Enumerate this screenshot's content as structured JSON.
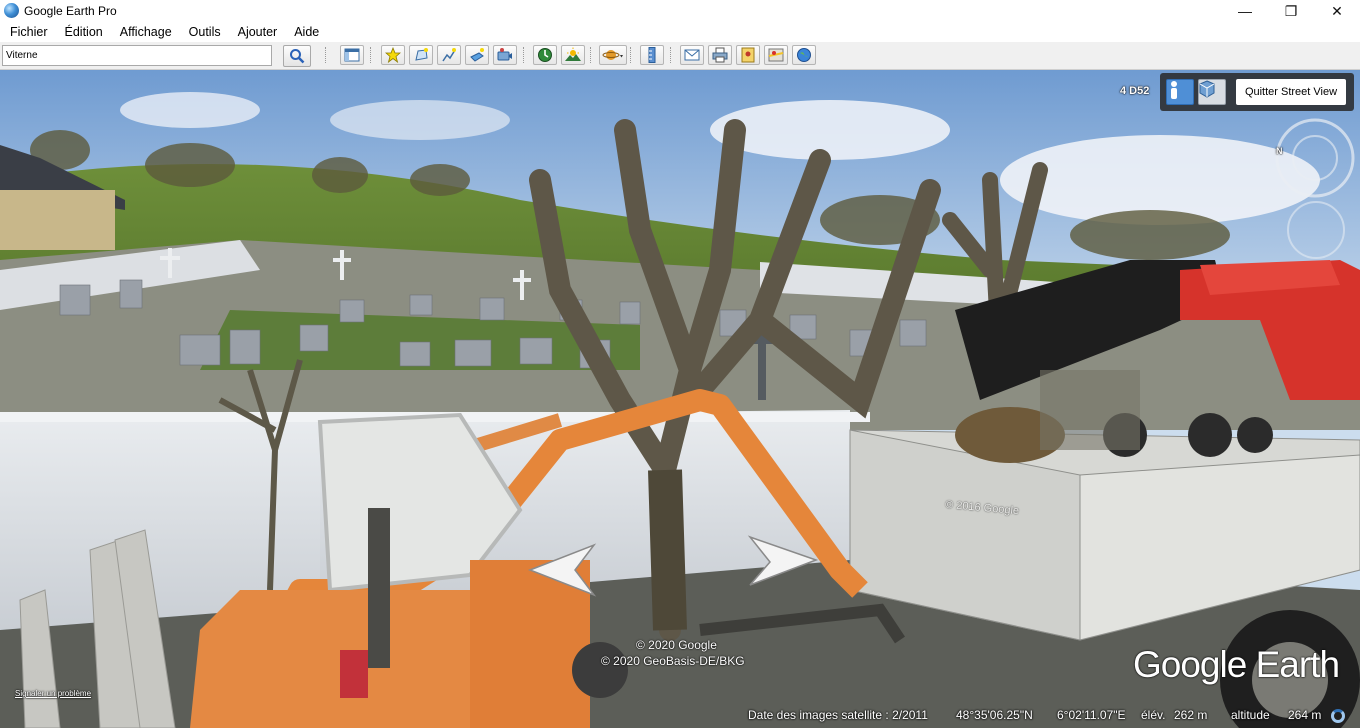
{
  "window": {
    "title": "Google Earth Pro",
    "controls": {
      "minimize": "—",
      "maximize": "❐",
      "close": "✕"
    }
  },
  "menu": {
    "items": [
      "Fichier",
      "Édition",
      "Affichage",
      "Outils",
      "Ajouter",
      "Aide"
    ]
  },
  "search": {
    "value": "Viterne"
  },
  "toolbar": {
    "icons": [
      "sidebar-toggle-icon",
      "placemark-icon",
      "polygon-icon",
      "path-icon",
      "image-overlay-icon",
      "record-tour-icon",
      "historical-imagery-icon",
      "sunlight-icon",
      "planets-icon",
      "ruler-icon",
      "email-icon",
      "print-icon",
      "save-image-icon",
      "google-maps-icon",
      "earth-icon"
    ]
  },
  "streetview": {
    "road_label": "4 D52",
    "exit_button": "Quitter Street View",
    "compass_letter": "N"
  },
  "scene": {
    "copyright_line1": "© 2020 Google",
    "copyright_line2": "© 2020 GeoBasis-DE/BKG",
    "report_link": "Signaler un problème",
    "brand": "Google Earth",
    "watermark": "© 2016 Google"
  },
  "status": {
    "imagery_date": "Date des images satellite : 2/2011",
    "latitude": "48°35'06.25\"N",
    "longitude": "6°02'11.07\"E",
    "elevation_label": "élév.",
    "elevation_value": "262 m",
    "altitude_label": "altitude",
    "altitude_value": "264 m"
  }
}
